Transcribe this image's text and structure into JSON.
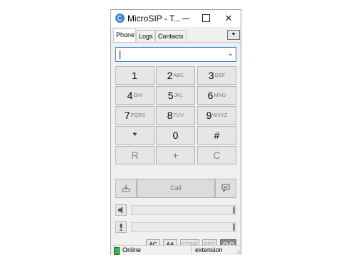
{
  "window": {
    "title": "MicroSIP - T...",
    "controls": {
      "minimize": "minimize",
      "maximize": "maximize",
      "close": "✕"
    }
  },
  "tabs": [
    {
      "label": "Phone",
      "active": true
    },
    {
      "label": "Logs",
      "active": false
    },
    {
      "label": "Contacts",
      "active": false
    }
  ],
  "tab_menu_icon": "▼",
  "dial": {
    "value": "",
    "dropdown_icon": "⌄"
  },
  "keypad": [
    {
      "digit": "1",
      "letters": ""
    },
    {
      "digit": "2",
      "letters": "ABC"
    },
    {
      "digit": "3",
      "letters": "DEF"
    },
    {
      "digit": "4",
      "letters": "GHI"
    },
    {
      "digit": "5",
      "letters": "JKL"
    },
    {
      "digit": "6",
      "letters": "MNO"
    },
    {
      "digit": "7",
      "letters": "PQRS"
    },
    {
      "digit": "8",
      "letters": "TUV"
    },
    {
      "digit": "9",
      "letters": "WXYZ"
    },
    {
      "digit": "*",
      "letters": ""
    },
    {
      "digit": "0",
      "letters": ""
    },
    {
      "digit": "#",
      "letters": ""
    },
    {
      "digit": "R",
      "letters": ""
    },
    {
      "digit": "+",
      "letters": ""
    },
    {
      "digit": "C",
      "letters": ""
    }
  ],
  "call_button": "Call",
  "buttons": {
    "ac": "AC",
    "aa": "AA",
    "conf": "CONF",
    "rec": "REC"
  },
  "volume": {
    "speaker_level": 1.0,
    "mic_level": 1.0
  },
  "status": {
    "text": "Online",
    "account": "extension",
    "color": "#2db84b"
  },
  "colors": {
    "accent": "#2a7ad8",
    "voicemail_button": "#8c8c8c"
  }
}
